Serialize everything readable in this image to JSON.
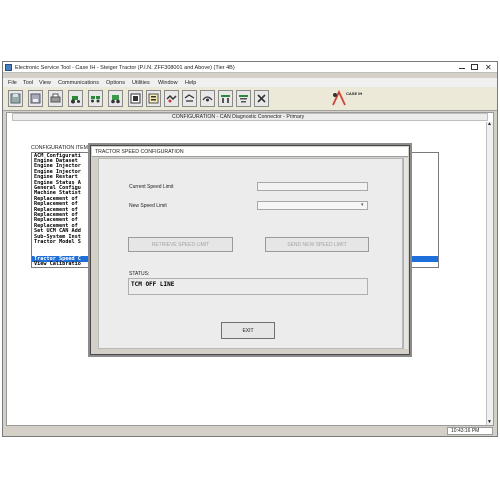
{
  "window": {
    "title": "Electronic Service Tool - Case IH - Steiger Tractor (P.I.N. ZFF308001 and Above) (Tier 4B)"
  },
  "menu": [
    "File",
    "Tool",
    "View",
    "Communications",
    "Options",
    "Utilities",
    "Window",
    "Help"
  ],
  "toolbar": {
    "icons": [
      "save-icon",
      "disk-icon",
      "print-icon",
      "tractor-icon",
      "tractor-group-icon",
      "tractor-alt-icon",
      "flash-icon",
      "wrench-arrow-icon",
      "signal-icon",
      "gauge-icon",
      "diagnostic-icon",
      "config-icon",
      "tools-icon",
      "logo-icon"
    ],
    "logo_text": "CASE IH"
  },
  "configuration_header": "CONFIGURATION  -  CAN Diagnostic Connector - Primary",
  "config_list": {
    "header": "CONFIGURATION ITEM SE",
    "items": [
      "ACM Configurati",
      "Engine Dataset",
      "Engine Injector",
      "Engine Injector",
      "Engine Restart",
      "Engine Status A",
      "General Configu",
      "Machine Statist",
      "Replacement of",
      "Replacement of",
      "Replacement of",
      "Replacement of",
      "Replacement of",
      "Replacement of",
      "Set UCM CAN Add",
      "Sub-System Inst",
      "Tractor Model S",
      "Tractor Speed C",
      "View Calibratio"
    ],
    "selected_index": 17
  },
  "dialog": {
    "title": "TRACTOR SPEED CONFIGURATION",
    "current_label": "Current Speed Limit",
    "current_value": "",
    "new_label": "New Speed Limit",
    "new_value": "",
    "retrieve_button": "RETRIEVE SPEED LIMIT",
    "send_button": "SEND NEW SPEED LIMIT",
    "status_label": "STATUS:",
    "status_value": "TCM OFF LINE",
    "exit_button": "EXIT"
  },
  "status_bar": {
    "time": "10:43:16 PM"
  },
  "colors": {
    "selection": "#1e6fd9",
    "window_bg": "#d4d0c8",
    "arrow": "#b8b8b8"
  }
}
